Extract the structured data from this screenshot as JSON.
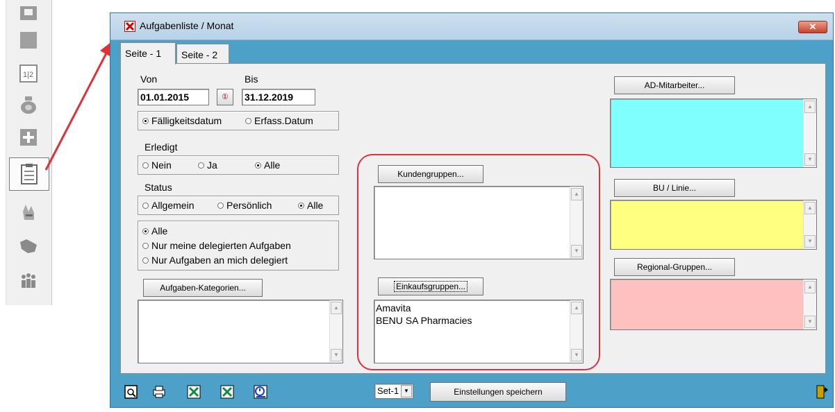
{
  "toolbar": {
    "icons": [
      "save-icon",
      "gray-square-icon",
      "calendar-fraction-icon",
      "pot-icon",
      "plus-icon",
      "clipboard-icon",
      "hand-icon",
      "map-icon",
      "people-icon"
    ]
  },
  "window": {
    "title": "Aufgabenliste / Monat",
    "close_label": "✕"
  },
  "tabs": [
    "Seite - 1",
    "Seite - 2"
  ],
  "dates": {
    "von_label": "Von",
    "von_value": "01.01.2015",
    "bis_label": "Bis",
    "bis_value": "31.12.2019",
    "calendar_glyph": "①"
  },
  "date_type": {
    "options": [
      "Fälligkeitsdatum",
      "Erfass.Datum"
    ],
    "selected": "Fälligkeitsdatum"
  },
  "erledigt": {
    "label": "Erledigt",
    "options": [
      "Nein",
      "Ja",
      "Alle"
    ],
    "selected": "Alle"
  },
  "status": {
    "label": "Status",
    "options": [
      "Allgemein",
      "Persönlich",
      "Alle"
    ],
    "selected": "Alle"
  },
  "delegation": {
    "options": [
      "Alle",
      "Nur meine delegierten Aufgaben",
      "Nur Aufgaben an mich delegiert"
    ],
    "selected": "Alle"
  },
  "kategorien": {
    "button": "Aufgaben-Kategorien...",
    "items": []
  },
  "kundengruppen": {
    "button": "Kundengruppen...",
    "items": []
  },
  "einkaufsgruppen": {
    "button": "Einkaufsgruppen...",
    "items": [
      "Amavita",
      "BENU SA Pharmacies"
    ]
  },
  "ad_mitarbeiter": {
    "button": "AD-Mitarbeiter...",
    "color": "#80ffff",
    "items": []
  },
  "bu_linie": {
    "button": "BU / Linie...",
    "color": "#ffff80",
    "items": []
  },
  "regional": {
    "button": "Regional-Gruppen...",
    "color": "#ffc0c0",
    "items": []
  },
  "bottom": {
    "set_value": "Set-1",
    "save_button": "Einstellungen speichern",
    "icons": [
      "print-preview-icon",
      "printer-icon",
      "excel-icon",
      "excel-export-icon",
      "clock-report-icon",
      "exit-door-icon"
    ]
  },
  "colors": {
    "accent": "#4da1c9",
    "annotation": "#e0303a"
  }
}
